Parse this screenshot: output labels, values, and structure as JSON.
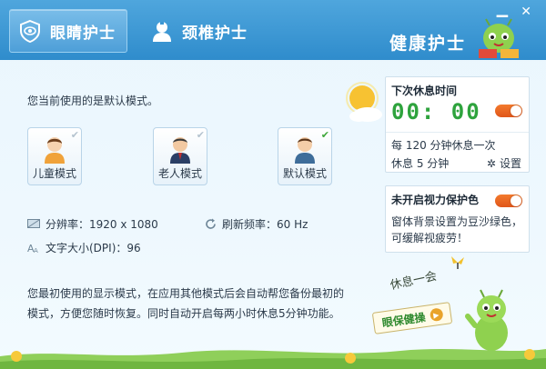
{
  "header": {
    "tabs": [
      {
        "label": "眼睛护士",
        "icon": "eye-shield-icon",
        "active": true
      },
      {
        "label": "颈椎护士",
        "icon": "nurse-icon",
        "active": false
      }
    ],
    "brand": "健康护士",
    "minimize_glyph": "▁",
    "close_glyph": "✕"
  },
  "main": {
    "intro": "您当前使用的是默认模式。",
    "modes": [
      {
        "label": "儿童模式",
        "icon": "child-avatar-icon",
        "selected": false
      },
      {
        "label": "老人模式",
        "icon": "elder-avatar-icon",
        "selected": false
      },
      {
        "label": "默认模式",
        "icon": "default-avatar-icon",
        "selected": true
      }
    ],
    "resolution": "分辨率：1920 x 1080",
    "refresh_rate": "刷新频率：60 Hz",
    "font_size": "文字大小(DPI)：96",
    "description": "您最初使用的显示模式，在应用其他模式后会自动帮您备份最初的模式，方便您随时恢复。同时自动开启每两小时休息5分钟功能。"
  },
  "rest_panel": {
    "title": "下次休息时间",
    "time": "00: 00",
    "toggle_on": true,
    "interval_line": "每 120 分钟休息一次",
    "duration_line": "休息  5  分钟",
    "settings_label": "设置"
  },
  "protect_panel": {
    "title": "未开启视力保护色",
    "toggle_on": true,
    "text": "窗体背景设置为豆沙绿色，可缓解视疲劳！"
  },
  "footer": {
    "rest_label": "休息一会",
    "exercise_button": "眼保健操"
  },
  "colors": {
    "header": "#3b96d3",
    "clock": "#2ea33d",
    "toggle": "#e8672a",
    "check_on": "#3fa73a"
  }
}
